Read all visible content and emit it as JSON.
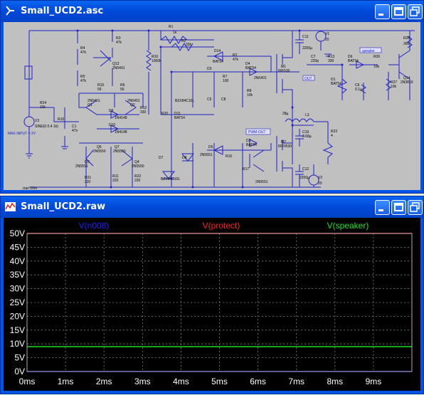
{
  "schematic_window": {
    "title": "Small_UCD2.asc",
    "icon": "schematic-icon",
    "labels": {
      "R1": "R1",
      "R1v": "1k",
      "R2": "R2",
      "R2v": "33k",
      "R3": "R3",
      "R3v": "47k",
      "R4": "R4",
      "R4v": "47k",
      "R5": "R5",
      "R5v": "47k",
      "R6": "R6",
      "R6v": "56",
      "R7": "R7",
      "R7v": "100",
      "R8": "R8",
      "R8v": "10k",
      "R9": "R9",
      "R9v": "56",
      "R10": "R10",
      "R10v": "1000k",
      "R11": "R11",
      "R11v": "220",
      "R12": "R12",
      "R12v": "330",
      "R13": "R13",
      "R13v": "330",
      "R14": "R14",
      "R14v": "1k",
      "R15": "R15",
      "R16": "R16",
      "R17": "R17",
      "R20": "R20",
      "R21": "R21",
      "R21v": "220",
      "R22": "R22",
      "R22v": "220",
      "R23": "R23",
      "R23v": "4",
      "R24": "R24",
      "R24v": "10k",
      "R26": "R26",
      "R26v": "10k",
      "R27": "R27",
      "R27v": "10k",
      "R28": "R28",
      "R28v": "390",
      "C1": "C1",
      "C1v": "47n",
      "C5": "C5",
      "C6": "C6",
      "C6v": "0.1µ",
      "C7": "C7",
      "C7v": "220p",
      "C8": "C8",
      "C11": "C11",
      "C11v": "2200µ",
      "C12": "C12",
      "C12v": "2200µ",
      "C19": "C19",
      "C19v": "0.68µ",
      "Q1": "Q1",
      "Q1v": "2N5401",
      "Q2": "Q2",
      "Q2v": "2N5401",
      "Q3": "Q3",
      "Q3v": "2N5551",
      "Q4": "Q4",
      "Q4v": "2N5550",
      "Q6": "Q6",
      "Q6v": "2N5550",
      "Q7": "Q7",
      "Q7v": "2N5550",
      "Q13": "Q13",
      "Q13v": "2N5401",
      "Q14": "Q14",
      "Q14v": "2N3819",
      "M1": "M1",
      "M1v": "IRF530",
      "M2": "M2",
      "M2v": "IRF9530",
      "D1": "D1",
      "D1v": "BAT54",
      "D2": "D2",
      "D2v": "BAT54",
      "D3": "D3",
      "D4": "D4",
      "D4v": "BAT54",
      "D5": "D5",
      "D6": "D6",
      "D6v": "BAT54",
      "D7": "D7",
      "D7v": "BZX84C10L",
      "D8": "D8",
      "D8v": "BZX84C10L",
      "D9": "D9",
      "D9v": "1N4148",
      "D10": "D10",
      "D10v": "1N4148",
      "D11": "D11",
      "D14": "D14",
      "D14v": "BAT54",
      "L2": "L2",
      "L2v": "28µ",
      "L3": "L3",
      "V1": "V1",
      "V2": "V2",
      "V3": "V3",
      "V1v": "20",
      "V2v": "20",
      "sine": "SINE(0 0.4 1k)",
      "max_input": "MAX INPUT = 2V",
      "tran": ".tran 10m",
      "pwm_out": "PWM-OUT",
      "out": "OUT",
      "sync": "SYNC",
      "protect": "protect",
      "input": "INPUT",
      "speaker": "speaker"
    }
  },
  "plot_window": {
    "title": "Small_UCD2.raw",
    "icon": "waveform-icon",
    "traces": [
      {
        "label": "V(n008)",
        "color": "#2020ff"
      },
      {
        "label": "V(protect)",
        "color": "#ff2020"
      },
      {
        "label": "V(speaker)",
        "color": "#20e020"
      }
    ],
    "y_ticks": [
      "50V",
      "45V",
      "40V",
      "35V",
      "30V",
      "25V",
      "20V",
      "15V",
      "10V",
      "5V",
      "0V"
    ],
    "x_ticks": [
      "0ms",
      "1ms",
      "2ms",
      "3ms",
      "4ms",
      "5ms",
      "6ms",
      "7ms",
      "8ms",
      "9ms"
    ]
  },
  "chart_data": {
    "type": "line",
    "x": [
      0,
      10
    ],
    "xlim": [
      0,
      10
    ],
    "ylim": [
      0,
      50
    ],
    "series": [
      {
        "name": "V(n008)",
        "values": [
          0,
          0
        ]
      },
      {
        "name": "V(protect)",
        "values": [
          50,
          50
        ]
      },
      {
        "name": "V(speaker)",
        "values": [
          9,
          9
        ]
      }
    ],
    "grid": true
  }
}
